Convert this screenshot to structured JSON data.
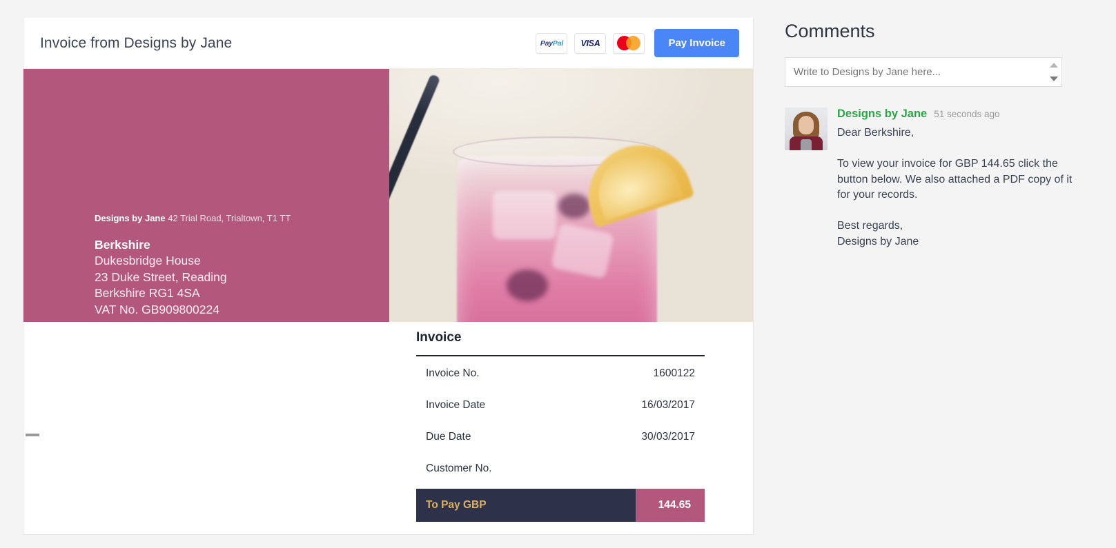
{
  "invoice_card": {
    "title": "Invoice from Designs by Jane",
    "payment_badges": [
      {
        "name": "paypal",
        "text_a": "Pay",
        "text_b": "Pal"
      },
      {
        "name": "visa",
        "text": "VISA"
      },
      {
        "name": "mastercard",
        "text": ""
      }
    ],
    "pay_button_label": "Pay Invoice",
    "accent_color": "#b4577c",
    "button_color": "#4a86f7",
    "total_bar_color": "#2d3149",
    "total_text_color": "#d9b166"
  },
  "sender": {
    "name": "Designs by Jane",
    "address_inline": "42 Trial Road, Trialtown, T1 TT"
  },
  "recipient": {
    "name": "Berkshire",
    "line1": "Dukesbridge House",
    "line2": "23 Duke Street, Reading",
    "line3": "Berkshire RG1 4SA",
    "line4": "VAT No. GB909800224"
  },
  "invoice_details": {
    "heading": "Invoice",
    "rows": [
      {
        "label": "Invoice No.",
        "value": "1600122"
      },
      {
        "label": "Invoice Date",
        "value": "16/03/2017"
      },
      {
        "label": "Due Date",
        "value": "30/03/2017"
      },
      {
        "label": "Customer No.",
        "value": ""
      }
    ],
    "total_label": "To Pay GBP",
    "total_value": "144.65"
  },
  "comments": {
    "title": "Comments",
    "input_placeholder": "Write to Designs by Jane here...",
    "input_value": "",
    "items": [
      {
        "author": "Designs by Jane",
        "time": "51 seconds ago",
        "body": "Dear Berkshire,\n\nTo view your invoice for GBP 144.65 click the button below. We also attached a PDF copy of it for your records.\n\nBest regards,\nDesigns by Jane"
      }
    ]
  }
}
